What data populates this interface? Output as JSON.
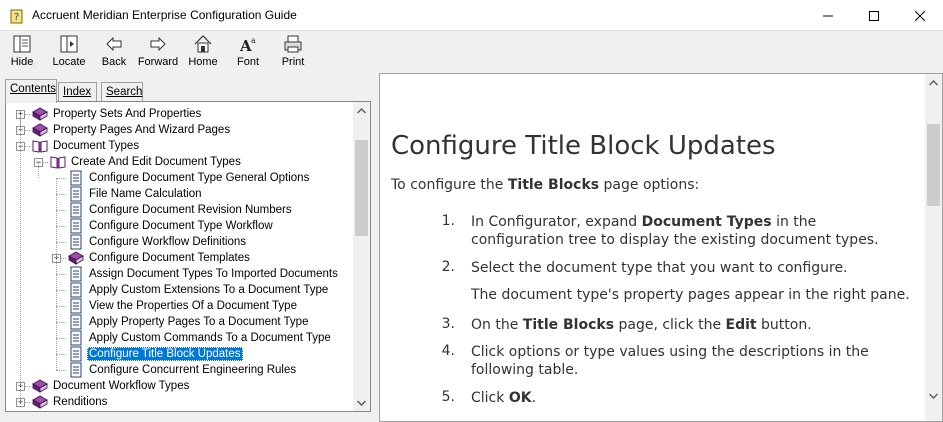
{
  "window": {
    "title": "Accruent Meridian Enterprise Configuration Guide"
  },
  "toolbar": {
    "buttons": [
      {
        "label": "Hide",
        "icon": "hide-icon"
      },
      {
        "label": "Locate",
        "icon": "locate-icon"
      },
      {
        "label": "Back",
        "icon": "back-arrow-icon"
      },
      {
        "label": "Forward",
        "icon": "forward-arrow-icon"
      },
      {
        "label": "Home",
        "icon": "home-icon"
      },
      {
        "label": "Font",
        "icon": "font-icon"
      },
      {
        "label": "Print",
        "icon": "print-icon"
      }
    ]
  },
  "tabs": [
    {
      "label": "Contents",
      "active": true
    },
    {
      "label": "Index",
      "active": false
    },
    {
      "label": "Search",
      "active": false
    }
  ],
  "tree": [
    {
      "label": "Property Sets And Properties",
      "type": "book"
    },
    {
      "label": "Property Pages And Wizard Pages",
      "type": "book"
    },
    {
      "label": "Document Types",
      "type": "open-book"
    },
    {
      "label": "Create And Edit Document Types",
      "type": "open-book"
    },
    {
      "label": "Configure Document Type General Options",
      "type": "page"
    },
    {
      "label": "File Name Calculation",
      "type": "page"
    },
    {
      "label": "Configure Document Revision Numbers",
      "type": "page"
    },
    {
      "label": "Configure Document Type Workflow",
      "type": "page"
    },
    {
      "label": "Configure Workflow Definitions",
      "type": "page"
    },
    {
      "label": "Configure Document Templates",
      "type": "book"
    },
    {
      "label": "Assign Document Types To Imported Documents",
      "type": "page"
    },
    {
      "label": "Apply Custom Extensions To a Document Type",
      "type": "page"
    },
    {
      "label": "View the Properties Of a Document Type",
      "type": "page"
    },
    {
      "label": "Apply Property Pages To a Document Type",
      "type": "page"
    },
    {
      "label": "Apply Custom Commands To a Document Type",
      "type": "page"
    },
    {
      "label": "Configure Title Block Updates",
      "type": "page",
      "selected": true
    },
    {
      "label": "Configure Concurrent Engineering Rules",
      "type": "page"
    },
    {
      "label": "Document Workflow Types",
      "type": "book"
    },
    {
      "label": "Renditions",
      "type": "book"
    }
  ],
  "content": {
    "heading": "Configure Title Block Updates",
    "intro_prefix": "To configure the ",
    "intro_bold": "Title Blocks",
    "intro_suffix": " page options:",
    "steps": [
      {
        "num": "1.",
        "pre": "In Configurator, expand ",
        "bold": "Document Types",
        "post": " in the configuration tree to display the existing document types."
      },
      {
        "num": "2.",
        "pre": "Select the document type that you want to configure.",
        "bold": "",
        "post": ""
      },
      {
        "num": "3.",
        "pre": "On the ",
        "bold": "Title Blocks",
        "post": " page, click the ",
        "bold2": "Edit",
        "post2": " button."
      },
      {
        "num": "4.",
        "pre": "Click options or type values using the descriptions in the following table.",
        "bold": "",
        "post": ""
      },
      {
        "num": "5.",
        "pre": "Click ",
        "bold": "OK",
        "post": "."
      }
    ],
    "step2_note": "The document type's property pages appear in the right pane."
  },
  "colors": {
    "selection": "#0078d7",
    "book_purple": "#7b2a8b",
    "text": "#333333"
  }
}
